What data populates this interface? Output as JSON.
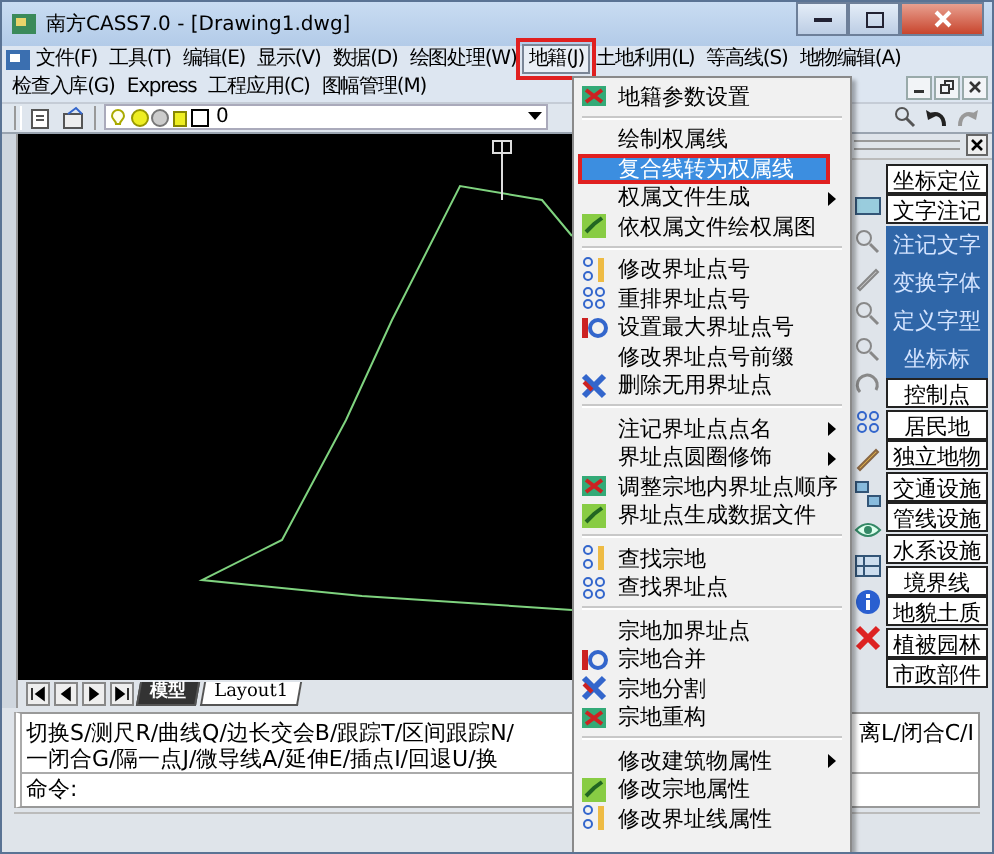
{
  "window": {
    "title": "南方CASS7.0 - [Drawing1.dwg]"
  },
  "menubar": {
    "items": [
      {
        "label": "文件(F)",
        "selected": false,
        "annotated": false
      },
      {
        "label": "工具(T)",
        "selected": false,
        "annotated": false
      },
      {
        "label": "编辑(E)",
        "selected": false,
        "annotated": false
      },
      {
        "label": "显示(V)",
        "selected": false,
        "annotated": false
      },
      {
        "label": "数据(D)",
        "selected": false,
        "annotated": false
      },
      {
        "label": "绘图处理(W)",
        "selected": false,
        "annotated": false
      },
      {
        "label": "地籍(J)",
        "selected": true,
        "annotated": true
      },
      {
        "label": "土地利用(L)",
        "selected": false,
        "annotated": false
      },
      {
        "label": "等高线(S)",
        "selected": false,
        "annotated": false
      },
      {
        "label": "地物编辑(A)",
        "selected": false,
        "annotated": false
      }
    ]
  },
  "secondary_menubar": {
    "items": [
      {
        "label": "检查入库(G)",
        "selected": false,
        "annotated": false
      },
      {
        "label": "Express",
        "selected": false,
        "annotated": false
      },
      {
        "label": "工程应用(C)",
        "selected": false,
        "annotated": false
      },
      {
        "label": "图幅管理(M)",
        "selected": false,
        "annotated": false
      }
    ]
  },
  "toolbar": {
    "layer": "0"
  },
  "drawing_tabs": [
    {
      "label": "模型",
      "selected": true
    },
    {
      "label": "Layout1",
      "selected": false
    }
  ],
  "popup_menu": {
    "items": [
      {
        "kind": "icon",
        "label": "地籍参数设置",
        "selected": false,
        "annotated": false
      },
      {
        "kind": "separator"
      },
      {
        "kind": "text",
        "label": "绘制权属线",
        "selected": false,
        "annotated": false
      },
      {
        "kind": "text",
        "label": "复合线转为权属线",
        "selected": true,
        "annotated": true
      },
      {
        "kind": "submenu",
        "label": "权属文件生成",
        "selected": false,
        "annotated": false
      },
      {
        "kind": "icon",
        "label": "依权属文件绘权属图",
        "selected": false,
        "annotated": false
      },
      {
        "kind": "separator"
      },
      {
        "kind": "icon",
        "label": "修改界址点号",
        "selected": false,
        "annotated": false
      },
      {
        "kind": "icon",
        "label": "重排界址点号",
        "selected": false,
        "annotated": false
      },
      {
        "kind": "icon",
        "label": "设置最大界址点号",
        "selected": false,
        "annotated": false
      },
      {
        "kind": "text",
        "label": "修改界址点号前缀",
        "selected": false,
        "annotated": false
      },
      {
        "kind": "icon",
        "label": "删除无用界址点",
        "selected": false,
        "annotated": false
      },
      {
        "kind": "separator"
      },
      {
        "kind": "submenu",
        "label": "注记界址点点名",
        "selected": false,
        "annotated": false
      },
      {
        "kind": "submenu",
        "label": "界址点圆圈修饰",
        "selected": false,
        "annotated": false
      },
      {
        "kind": "icon",
        "label": "调整宗地内界址点顺序",
        "selected": false,
        "annotated": false
      },
      {
        "kind": "icon",
        "label": "界址点生成数据文件",
        "selected": false,
        "annotated": false
      },
      {
        "kind": "separator"
      },
      {
        "kind": "icon",
        "label": "查找宗地",
        "selected": false,
        "annotated": false
      },
      {
        "kind": "icon",
        "label": "查找界址点",
        "selected": false,
        "annotated": false
      },
      {
        "kind": "separator"
      },
      {
        "kind": "text",
        "label": "宗地加界址点",
        "selected": false,
        "annotated": false
      },
      {
        "kind": "icon",
        "label": "宗地合并",
        "selected": false,
        "annotated": false
      },
      {
        "kind": "icon",
        "label": "宗地分割",
        "selected": false,
        "annotated": false
      },
      {
        "kind": "icon",
        "label": "宗地重构",
        "selected": false,
        "annotated": false
      },
      {
        "kind": "separator"
      },
      {
        "kind": "submenu",
        "label": "修改建筑物属性",
        "selected": false,
        "annotated": false
      },
      {
        "kind": "icon",
        "label": "修改宗地属性",
        "selected": false,
        "annotated": false
      },
      {
        "kind": "icon",
        "label": "修改界址线属性",
        "selected": false,
        "annotated": false
      }
    ]
  },
  "side_panel": {
    "items": [
      {
        "kind": "button",
        "label": "坐标定位"
      },
      {
        "kind": "button",
        "label": "文字注记"
      },
      {
        "kind": "listitem",
        "label": "注记文字"
      },
      {
        "kind": "listitem",
        "label": "变换字体"
      },
      {
        "kind": "listitem",
        "label": "定义字型"
      },
      {
        "kind": "listitem",
        "label": "坐标标"
      },
      {
        "kind": "button",
        "label": "控制点"
      },
      {
        "kind": "button",
        "label": "居民地"
      },
      {
        "kind": "button",
        "label": "独立地物"
      },
      {
        "kind": "button",
        "label": "交通设施"
      },
      {
        "kind": "button",
        "label": "管线设施"
      },
      {
        "kind": "button",
        "label": "水系设施"
      },
      {
        "kind": "button",
        "label": "境界线"
      },
      {
        "kind": "button",
        "label": "地貌土质"
      },
      {
        "kind": "button",
        "label": "植被园林"
      },
      {
        "kind": "button",
        "label": "市政部件"
      }
    ]
  },
  "command": {
    "lines": [
      {
        "text": "切换S/测尺R/曲线Q/边长交会B/跟踪T/区间跟踪N/",
        "tail": "离L/闭合C/I"
      },
      {
        "text": "一闭合G/隔一点J/微导线A/延伸E/插点I/回退U/换"
      }
    ],
    "prompt": "命令:"
  }
}
